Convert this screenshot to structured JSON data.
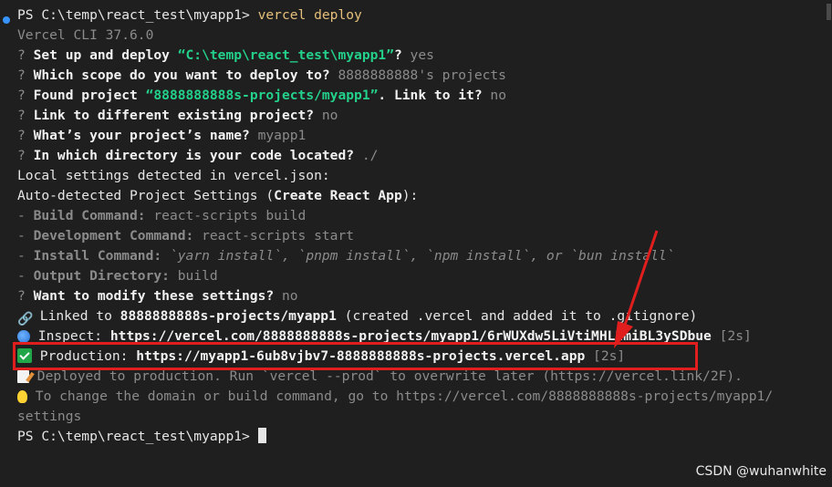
{
  "terminal": {
    "prompt": "PS C:\\temp\\react_test\\myapp1> ",
    "command": "vercel deploy",
    "cli_version": "Vercel CLI 37.6.0",
    "q1_mark": "? ",
    "q1_text": "Set up and deploy ",
    "q1_path": "“C:\\temp\\react_test\\myapp1”",
    "q1_suffix": "? ",
    "q1_answer": "yes",
    "q2_text": "Which scope do you want to deploy to? ",
    "q2_answer": "8888888888's projects",
    "q3_text": "Found project ",
    "q3_project": "“8888888888s-projects/myapp1”",
    "q3_suffix": ". Link to it? ",
    "q3_answer": "no",
    "q4_text": "Link to different existing project? ",
    "q4_answer": "no",
    "q5_text": "What’s your project’s name? ",
    "q5_answer": "myapp1",
    "q6_text": "In which directory is your code located? ",
    "q6_answer": "./",
    "local_settings": "Local settings detected in vercel.json:",
    "auto_detected_prefix": "Auto-detected Project Settings (",
    "auto_detected_framework": "Create React App",
    "auto_detected_suffix": "):",
    "build_label": "Build Command:",
    "build_value": " react-scripts build",
    "dev_label": "Development Command:",
    "dev_value": " react-scripts start",
    "install_label": "Install Command:",
    "install_value": " `yarn install`, `pnpm install`, `npm install`, or `bun install`",
    "output_label": "Output Directory:",
    "output_value": " build",
    "dash": "- ",
    "modify_text": "Want to modify these settings? ",
    "modify_answer": "no",
    "linked_prefix": " Linked to ",
    "linked_project": "8888888888s-projects/myapp1",
    "linked_suffix": " (created .vercel and added it to .gitignore)",
    "inspect_label": " Inspect: ",
    "inspect_url": "https://vercel.com/8888888888s-projects/myapp1/6rWUXdw5LiVtiMHL2miBL3ySDbue",
    "inspect_time": " [2s]",
    "production_label": " Production: ",
    "production_url": "https://myapp1-6ub8vjbv7-8888888888s-projects.vercel.app",
    "production_time": " [2s]",
    "deployed_text": " Deployed to production. Run `vercel --prod` to overwrite later (https://vercel.link/2F).",
    "tip_text": " To change the domain or build command, go to https://vercel.com/8888888888s-projects/myapp1/",
    "tip_wrap": "settings",
    "final_prompt": "PS C:\\temp\\react_test\\myapp1> "
  },
  "icons": {
    "link": "link-icon",
    "inspect": "globe-icon",
    "production": "check-mark-icon",
    "deployed": "memo-icon",
    "tip": "light-bulb-icon"
  },
  "annotation_color": "#e01e1e",
  "watermark": "CSDN @wuhanwhite"
}
